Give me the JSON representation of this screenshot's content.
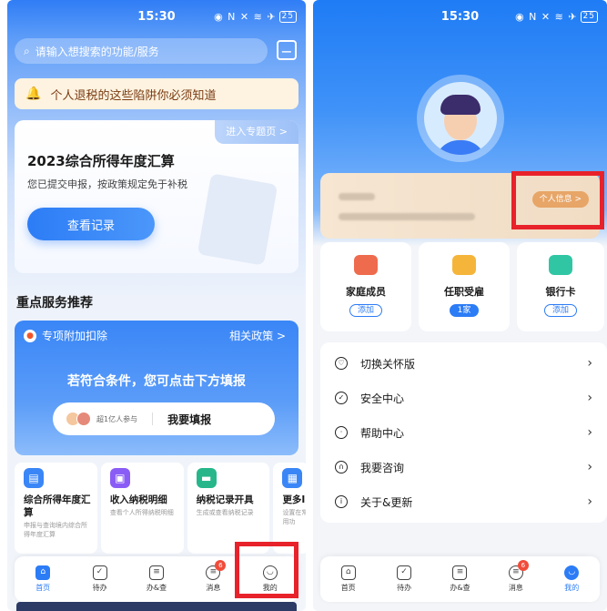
{
  "status_bar": {
    "time": "15:30",
    "icons": "◉ N ✕ ≋ ✈",
    "battery": "25"
  },
  "left": {
    "search": {
      "placeholder": "请输入想搜索的功能/服务"
    },
    "notice": "个人退税的这些陷阱你必须知道",
    "main_card": {
      "topic_link": "进入专题页 >",
      "title": "2023综合所得年度汇算",
      "subtitle": "您已提交申报，按政策规定免于补税",
      "button": "查看记录"
    },
    "section_title": "重点服务推荐",
    "deduction": {
      "tag": "专项附加扣除",
      "policy_link": "相关政策 >",
      "message": "若符合条件，您可点击下方填报",
      "participants": "超1亿人参与",
      "fill_button": "我要填报"
    },
    "services": [
      {
        "name": "综合所得年度汇算",
        "desc": "申报与查询境内综合所得年度汇算",
        "icon": "calc-icon",
        "color": "#3a86f7"
      },
      {
        "name": "收入纳税明细",
        "desc": "查看个人所得纳税明细",
        "icon": "wallet-icon",
        "color": "#8a5cf6"
      },
      {
        "name": "纳税记录开具",
        "desc": "生成或查看纳税记录",
        "icon": "card-icon",
        "color": "#26b68a"
      },
      {
        "name": "更多I",
        "desc": "设置在常用功",
        "icon": "grid-icon",
        "color": "#3a86f7"
      }
    ]
  },
  "tabs": [
    {
      "label": "首页",
      "icon": "home-icon",
      "active": true
    },
    {
      "label": "待办",
      "icon": "calendar-check-icon"
    },
    {
      "label": "办&查",
      "icon": "doc-search-icon"
    },
    {
      "label": "消息",
      "icon": "message-icon",
      "badge": "6"
    },
    {
      "label": "我的",
      "icon": "user-smile-icon"
    }
  ],
  "right": {
    "info_button": "个人信息 >",
    "family": [
      {
        "label": "家庭成员",
        "tag": "添加",
        "icon_color": "#ee6b4d"
      },
      {
        "label": "任职受雇",
        "tag": "1家",
        "icon_color": "#f5b53a"
      },
      {
        "label": "银行卡",
        "tag": "添加",
        "icon_color": "#30c6a3"
      }
    ],
    "menu": [
      {
        "label": "切换关怀版",
        "icon": "heart-icon"
      },
      {
        "label": "安全中心",
        "icon": "shield-icon"
      },
      {
        "label": "帮助中心",
        "icon": "bulb-icon"
      },
      {
        "label": "我要咨询",
        "icon": "headset-icon"
      },
      {
        "label": "关于&更新",
        "icon": "info-icon"
      }
    ],
    "tabs": [
      {
        "label": "首页",
        "icon": "home-icon"
      },
      {
        "label": "待办",
        "icon": "calendar-check-icon"
      },
      {
        "label": "办&查",
        "icon": "doc-search-icon"
      },
      {
        "label": "消息",
        "icon": "message-icon",
        "badge": "6"
      },
      {
        "label": "我的",
        "icon": "user-smile-icon",
        "active": true
      }
    ]
  },
  "colors": {
    "accent": "#2c7cf6",
    "highlight": "#e8222a",
    "notice_bg": "#fdf3e0"
  }
}
